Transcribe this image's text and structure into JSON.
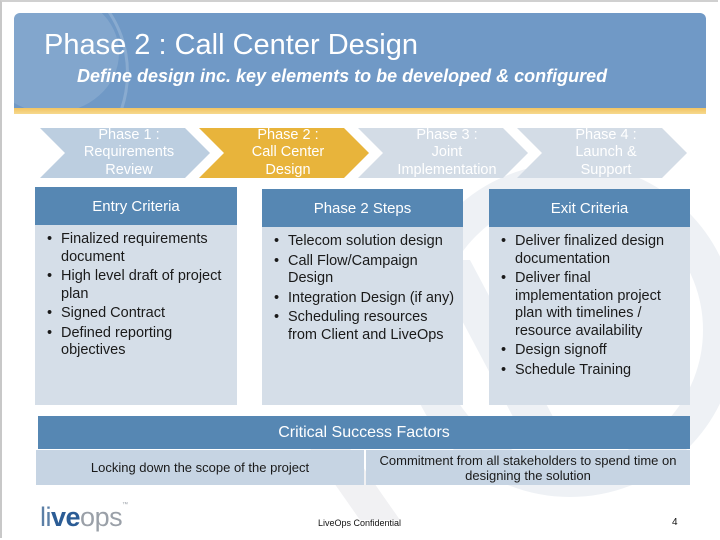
{
  "header": {
    "title": "Phase 2 : Call Center Design",
    "subtitle": "Define design inc. key elements to be developed & configured"
  },
  "colors": {
    "banner": "#7099c6",
    "stripe": "#f2c462",
    "phase_inactive": "#d3dce6",
    "phase_done": "#bccee0",
    "phase_active": "#e8b43b",
    "box_header": "#5687b3",
    "box_body": "#d5dee8",
    "csf_cell": "#c6d4e3"
  },
  "phases": [
    {
      "label_lines": [
        "Phase 1 :",
        "Requirements",
        "Review"
      ],
      "state": "completed"
    },
    {
      "label_lines": [
        "Phase 2 :",
        "Call Center",
        "Design"
      ],
      "state": "active"
    },
    {
      "label_lines": [
        "Phase 3 :",
        "Joint",
        "Implementation"
      ],
      "state": "upcoming"
    },
    {
      "label_lines": [
        "Phase 4 :",
        "Launch &",
        "Support"
      ],
      "state": "upcoming"
    }
  ],
  "entry_criteria": {
    "title": "Entry Criteria",
    "items": [
      "Finalized requirements document",
      "High level draft of project plan",
      "Signed Contract",
      "Defined reporting objectives"
    ]
  },
  "phase_steps": {
    "title": "Phase 2 Steps",
    "items": [
      "Telecom solution design",
      "Call Flow/Campaign Design",
      "Integration Design (if any)",
      "Scheduling resources from Client and LiveOps"
    ]
  },
  "exit_criteria": {
    "title": "Exit Criteria",
    "items": [
      "Deliver finalized design documentation",
      "Deliver final implementation project plan with timelines / resource availability",
      "Design signoff",
      "Schedule Training"
    ]
  },
  "critical_success_factors": {
    "title": "Critical Success Factors",
    "factors": [
      "Locking down the scope of the project",
      "Commitment from all stakeholders to spend time on designing the solution"
    ]
  },
  "footer": {
    "logo_parts": [
      "li",
      "ve",
      "ops"
    ],
    "logo_tm": "™",
    "confidential": "LiveOps Confidential",
    "page_number": "4"
  }
}
